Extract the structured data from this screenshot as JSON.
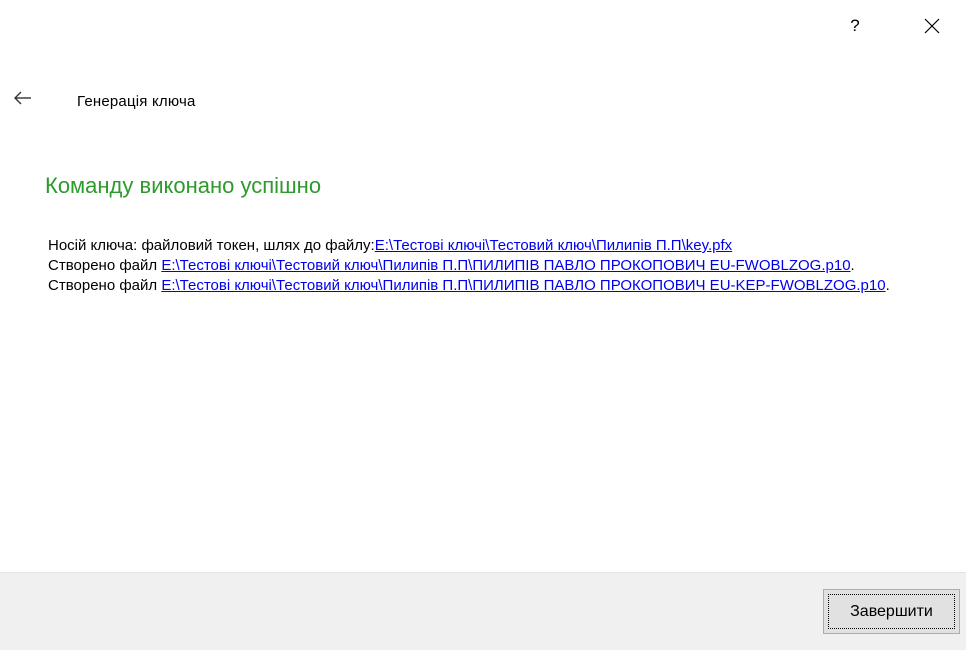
{
  "window": {
    "help_label": "?",
    "close_icon": "close-icon"
  },
  "header": {
    "back_icon": "arrow-left-icon",
    "title": "Генерація ключа"
  },
  "main": {
    "heading": "Команду виконано успішно",
    "heading_color": "#2c9a2c",
    "lines": [
      {
        "prefix": "Носій ключа: файловий токен, шлях до файлу:",
        "link": "E:\\Тестові ключі\\Тестовий ключ\\Пилипів П.П\\key.pfx",
        "suffix": ""
      },
      {
        "prefix": "Створено файл ",
        "link": "E:\\Тестові ключі\\Тестовий ключ\\Пилипів П.П\\ПИЛИПІВ ПАВЛО ПРОКОПОВИЧ EU-FWOBLZOG.p10",
        "suffix": "."
      },
      {
        "prefix": "Створено файл ",
        "link": "E:\\Тестові ключі\\Тестовий ключ\\Пилипів П.П\\ПИЛИПІВ ПАВЛО ПРОКОПОВИЧ EU-KEP-FWOBLZOG.p10",
        "suffix": "."
      }
    ],
    "link_color": "#0000ee"
  },
  "footer": {
    "finish_label": "Завершити"
  }
}
